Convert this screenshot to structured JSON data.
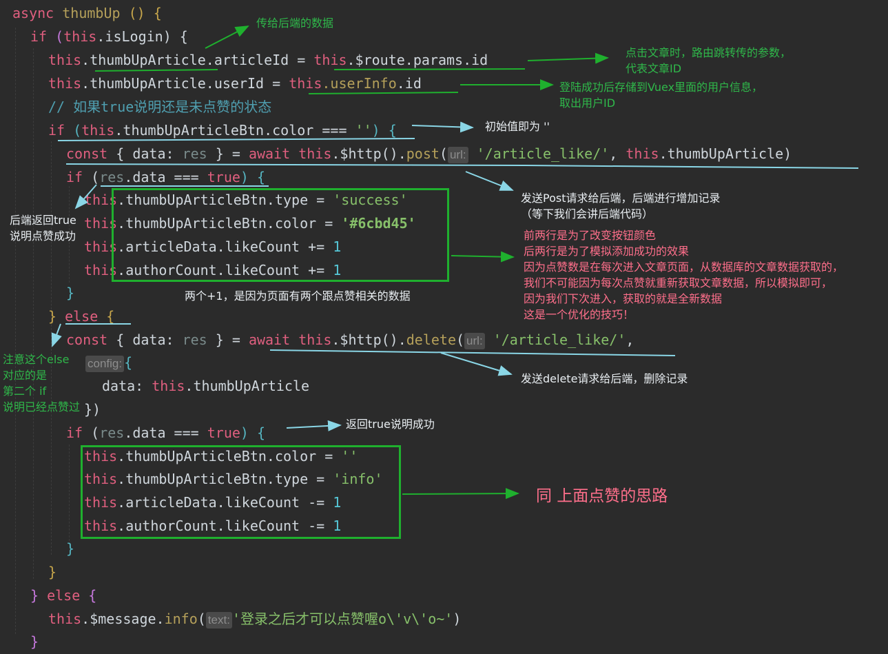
{
  "code": {
    "l1": {
      "kw": "async",
      "fn": "thumbUp",
      "rest": " () {"
    },
    "l2": {
      "kw": "if",
      "this": "this",
      "rest": ".isLogin) {"
    },
    "l3": {
      "this": "this",
      "mid": ".thumbUpArticle.articleId = ",
      "this2": "this",
      "tail": ".$route.params.id"
    },
    "l4": {
      "this": "this",
      "mid": ".thumbUpArticle.userId = ",
      "this2": "this",
      "prop": ".userInfo",
      "tail": ".id"
    },
    "l5": {
      "comment": "// 如果true说明还是未点赞的状态"
    },
    "l6": {
      "kw": "if",
      "this": "this",
      "mid": ".thumbUpArticleBtn.color === ",
      "str": "''",
      "tail": ") {"
    },
    "l7": {
      "kw": "const",
      "a": " { data: ",
      "res": "res",
      "b": " } = ",
      "await": "await",
      "this": "this",
      "c": ".$http().",
      "post": "post",
      "hint": "url:",
      "str": "'/article_like/'",
      "d": ", ",
      "this2": "this",
      "e": ".thumbUpArticle)"
    },
    "l8": {
      "kw": "if",
      "a": " (",
      "res": "res",
      "b": ".data === ",
      "t": "true",
      "c": ") {"
    },
    "l9": {
      "this": "this",
      "mid": ".thumbUpArticleBtn.type = ",
      "str": "'success'"
    },
    "l10": {
      "this": "this",
      "mid": ".thumbUpArticleBtn.color = ",
      "str": "'#6cbd45'"
    },
    "l11": {
      "this": "this",
      "mid": ".articleData.likeCount += ",
      "num": "1"
    },
    "l12": {
      "this": "this",
      "mid": ".authorCount.likeCount += ",
      "num": "1"
    },
    "l13": {
      "t": "}"
    },
    "l14": {
      "a": "} ",
      "kw": "else",
      "b": " {"
    },
    "l15": {
      "kw": "const",
      "a": " { data: ",
      "res": "res",
      "b": " } = ",
      "await": "await",
      "this": "this",
      "c": ".$http().",
      "del": "delete",
      "hint": "url:",
      "str": "'/article_like/'",
      "d": ","
    },
    "l16": {
      "hint": "config:",
      "t": "{"
    },
    "l17": {
      "a": "data: ",
      "this": "this",
      "b": ".thumbUpArticle"
    },
    "l18": {
      "t": "})"
    },
    "l19": {
      "kw": "if",
      "a": " (",
      "res": "res",
      "b": ".data === ",
      "t": "true",
      "c": ") {"
    },
    "l20": {
      "this": "this",
      "mid": ".thumbUpArticleBtn.color = ",
      "str": "''"
    },
    "l21": {
      "this": "this",
      "mid": ".thumbUpArticleBtn.type = ",
      "str": "'info'"
    },
    "l22": {
      "this": "this",
      "mid": ".articleData.likeCount -= ",
      "num": "1"
    },
    "l23": {
      "this": "this",
      "mid": ".authorCount.likeCount -= ",
      "num": "1"
    },
    "l24": {
      "t": "}"
    },
    "l25": {
      "t": "}"
    },
    "l26": {
      "a": "} ",
      "kw": "else",
      "b": " {"
    },
    "l27": {
      "this": "this",
      "a": ".$message.",
      "info": "info",
      "hint": "text:",
      "str": "'登录之后才可以点赞喔o\\'v\\'o~'",
      "b": ")"
    },
    "l28": {
      "t": "}"
    }
  },
  "annotations": {
    "a1": "传给后端的数据",
    "a2": "点击文章时，路由跳转传的参数，\n代表文章ID",
    "a3": "登陆成功后存储到Vuex里面的用户信息，\n取出用户ID",
    "a4": "初始值即为 ''",
    "a5": "发送Post请求给后端，后端进行增加记录\n（等下我们会讲后端代码）",
    "a6": "后端返回true\n说明点赞成功",
    "a7": "前两行是为了改变按钮颜色\n后两行是为了模拟添加成功的效果\n因为点赞数是在每次进入文章页面，从数据库的文章数据获取的，\n我们不可能因为每次点赞就重新获取文章数据，所以模拟即可，\n因为我们下次进入，获取的就是全新数据\n这是一个优化的技巧！",
    "a8": "两个+1，是因为页面有两个跟点赞相关的数据",
    "a9": "注意这个else\n对应的是\n第二个 if\n说明已经点赞过",
    "a10": "发送delete请求给后端，删除记录",
    "a11": "返回true说明成功",
    "a12": "同 上面点赞的思路"
  },
  "colors": {
    "background": "#2b2b2b",
    "keyword": "#e05f7f",
    "string": "#87c06a",
    "number": "#56c8d8",
    "annotation_green": "#2fb84a",
    "annotation_pink": "#ff6f8b",
    "box": "#1fb02e",
    "arrow": "#8ad6e6"
  }
}
